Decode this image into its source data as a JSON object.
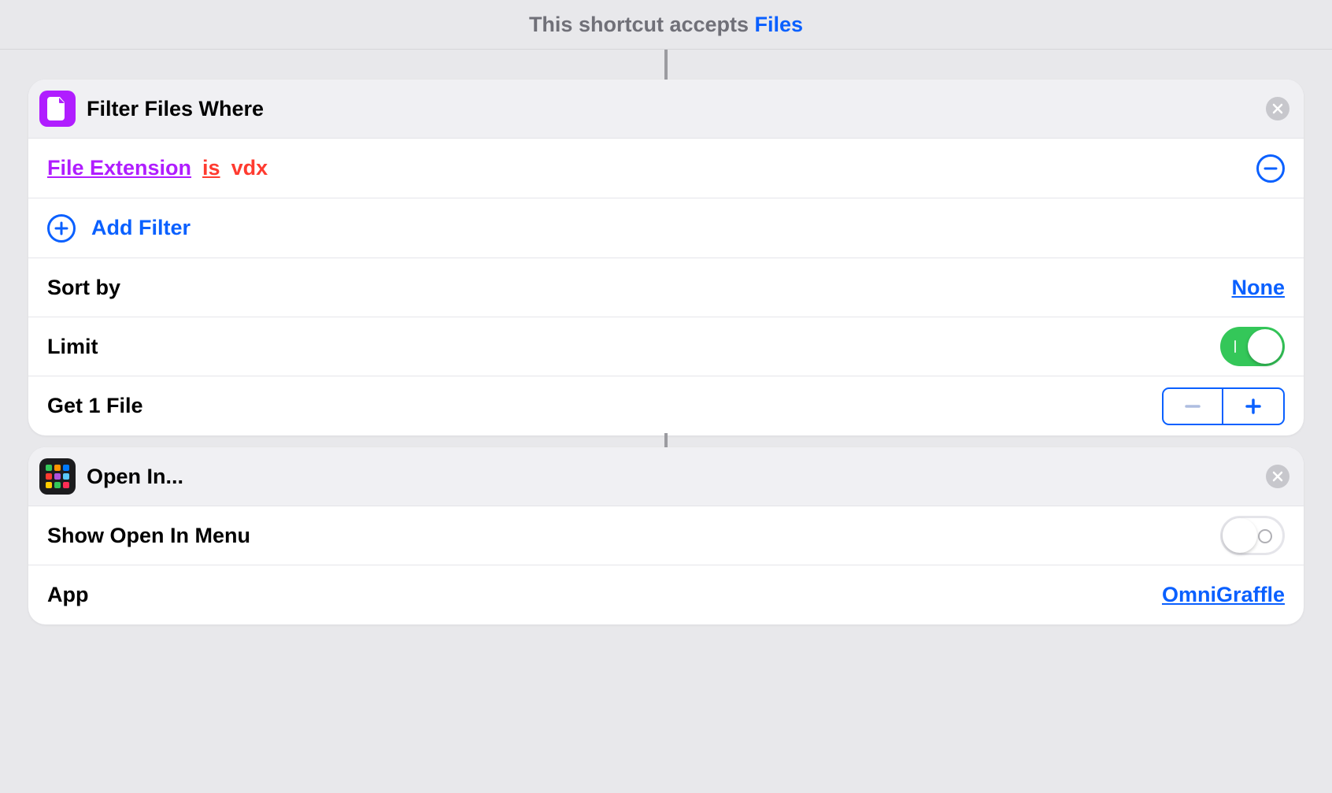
{
  "header": {
    "prefix": "This shortcut accepts ",
    "input_type": "Files"
  },
  "actions": [
    {
      "icon_color": "#b01dff",
      "title": "Filter Files Where",
      "filter": {
        "attribute": "File Extension",
        "operator": "is",
        "value": "vdx"
      },
      "add_filter_label": "Add Filter",
      "sort_label": "Sort by",
      "sort_value": "None",
      "limit_label": "Limit",
      "limit_on": true,
      "get_label": "Get 1 File"
    },
    {
      "title": "Open In...",
      "grid_colors": [
        "#34c759",
        "#ff9500",
        "#007aff",
        "#ff3b30",
        "#af52de",
        "#5ac8fa",
        "#ffcc00",
        "#34c759",
        "#ff2d55"
      ],
      "show_menu_label": "Show Open In Menu",
      "show_menu_on": false,
      "app_label": "App",
      "app_value": "OmniGraffle"
    }
  ]
}
